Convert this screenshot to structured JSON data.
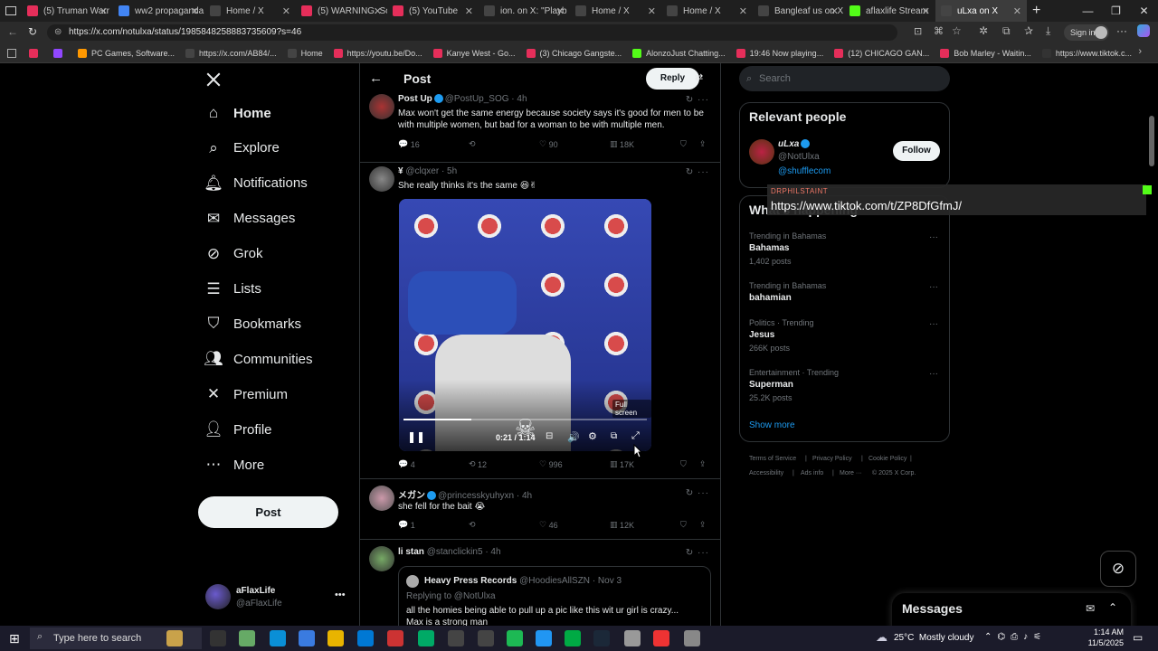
{
  "browser": {
    "tabs": [
      {
        "title": "(5) Truman Warr",
        "color": "#e52e5a"
      },
      {
        "title": "ww2 propaganda",
        "color": "#4285f4"
      },
      {
        "title": "Home / X",
        "color": "#444"
      },
      {
        "title": "(5) WARNING: Sc",
        "color": "#e52e5a"
      },
      {
        "title": "(5) YouTube",
        "color": "#e52e5a"
      },
      {
        "title": "ion. on X: \"Playb",
        "color": "#444"
      },
      {
        "title": "Home / X",
        "color": "#444"
      },
      {
        "title": "Home / X",
        "color": "#444"
      },
      {
        "title": "Bangleaf us on X",
        "color": "#444"
      },
      {
        "title": "aflaxlife Stream",
        "color": "#53fc18"
      },
      {
        "title": "uLxa on X",
        "color": "#444"
      }
    ],
    "url": "https://x.com/notulxa/status/1985848258883735609?s=46",
    "sign_in": "Sign in",
    "bookmarks": [
      {
        "label": "",
        "color": "#e52e5a"
      },
      {
        "label": "",
        "color": "#9147ff"
      },
      {
        "label": "PC Games, Software...",
        "color": "#ff9800"
      },
      {
        "label": "https://x.com/AB84/...",
        "color": "#444"
      },
      {
        "label": "Home",
        "color": "#444"
      },
      {
        "label": "https://youtu.be/Do...",
        "color": "#e52e5a"
      },
      {
        "label": "Kanye West - Go...",
        "color": "#e52e5a"
      },
      {
        "label": "(3) Chicago Gangste...",
        "color": "#e52e5a"
      },
      {
        "label": "AlonzoJust Chatting...",
        "color": "#53fc18"
      },
      {
        "label": "19:46 Now playing...",
        "color": "#e52e5a"
      },
      {
        "label": "(12) CHICAGO GAN...",
        "color": "#e52e5a"
      },
      {
        "label": "Bob Marley - Waitin...",
        "color": "#e52e5a"
      },
      {
        "label": "https://www.tiktok.c...",
        "color": "#333"
      }
    ]
  },
  "sidebar": {
    "items": [
      {
        "label": "Home",
        "icon": "home-icon"
      },
      {
        "label": "Explore",
        "icon": "search-icon"
      },
      {
        "label": "Notifications",
        "icon": "bell-icon"
      },
      {
        "label": "Messages",
        "icon": "mail-icon"
      },
      {
        "label": "Grok",
        "icon": "grok-icon"
      },
      {
        "label": "Lists",
        "icon": "list-icon"
      },
      {
        "label": "Bookmarks",
        "icon": "bookmark-icon"
      },
      {
        "label": "Communities",
        "icon": "people-icon"
      },
      {
        "label": "Premium",
        "icon": "x-icon"
      },
      {
        "label": "Profile",
        "icon": "person-icon"
      },
      {
        "label": "More",
        "icon": "more-icon"
      }
    ],
    "post_button": "Post",
    "account": {
      "name": "aFlaxLife",
      "handle": "@aFlaxLife"
    }
  },
  "header": {
    "title": "Post",
    "reply_button": "Reply"
  },
  "tweets": [
    {
      "name": "Post Up",
      "handle": "@PostUp_SOG",
      "time": "· 4h",
      "text": "Max won't get the same energy because society says it's good for men to be with multiple women, but bad for a woman to be with multiple men.",
      "replies": "16",
      "retweets": "",
      "likes": "90",
      "views": "18K"
    },
    {
      "name": "¥",
      "handle": "@clqxer",
      "time": "· 5h",
      "text": "She really thinks it's the same 😆✌",
      "replies": "4",
      "retweets": "12",
      "likes": "996",
      "views": "17K"
    },
    {
      "name": "メガン",
      "handle": "@princesskyuhyxn",
      "time": "· 4h",
      "text": "she fell for the bait 😭",
      "replies": "1",
      "retweets": "",
      "likes": "46",
      "views": "12K"
    },
    {
      "name": "li stan",
      "handle": "@stanclickin5",
      "time": "· 4h",
      "text": ""
    }
  ],
  "video": {
    "time": "0:21 / 1:14",
    "tooltip": "Full screen",
    "progress": 0.28
  },
  "quote": {
    "name": "Heavy Press Records",
    "handle": "@HoodiesAllSZN",
    "time": "· Nov 3",
    "replying": "Replying to @NotUlxa",
    "text": "all the homies being able to pull up a pic like this wit ur girl is crazy...",
    "text2": "Max is a strong man"
  },
  "right": {
    "search_placeholder": "Search",
    "relevant_title": "Relevant people",
    "person": {
      "name": "uLxa",
      "handle": "@NotUlxa",
      "link": "@shufflecom"
    },
    "follow": "Follow",
    "overlay_label": "DRPHILSTAINT",
    "overlay_url": "https://www.tiktok.com/t/ZP8DfGfmJ/",
    "whats_happening": "What's happening",
    "trends": [
      {
        "context": "Trending in Bahamas",
        "name": "Bahamas",
        "count": "1,402 posts"
      },
      {
        "context": "Trending in Bahamas",
        "name": "bahamian",
        "count": ""
      },
      {
        "context": "Politics · Trending",
        "name": "Jesus",
        "count": "266K posts"
      },
      {
        "context": "Entertainment · Trending",
        "name": "Superman",
        "count": "25.2K posts"
      }
    ],
    "show_more": "Show more",
    "footer": [
      "Terms of Service",
      "|",
      "Privacy Policy",
      "|",
      "Cookie Policy",
      "|",
      "Accessibility",
      "|",
      "Ads info",
      "|",
      "More ···",
      "© 2025 X Corp."
    ]
  },
  "messages_drawer": {
    "title": "Messages"
  },
  "taskbar": {
    "search_placeholder": "Type here to search",
    "weather": "25°C  Mostly cloudy",
    "time": "1:14 AM",
    "date": "11/5/2025"
  }
}
